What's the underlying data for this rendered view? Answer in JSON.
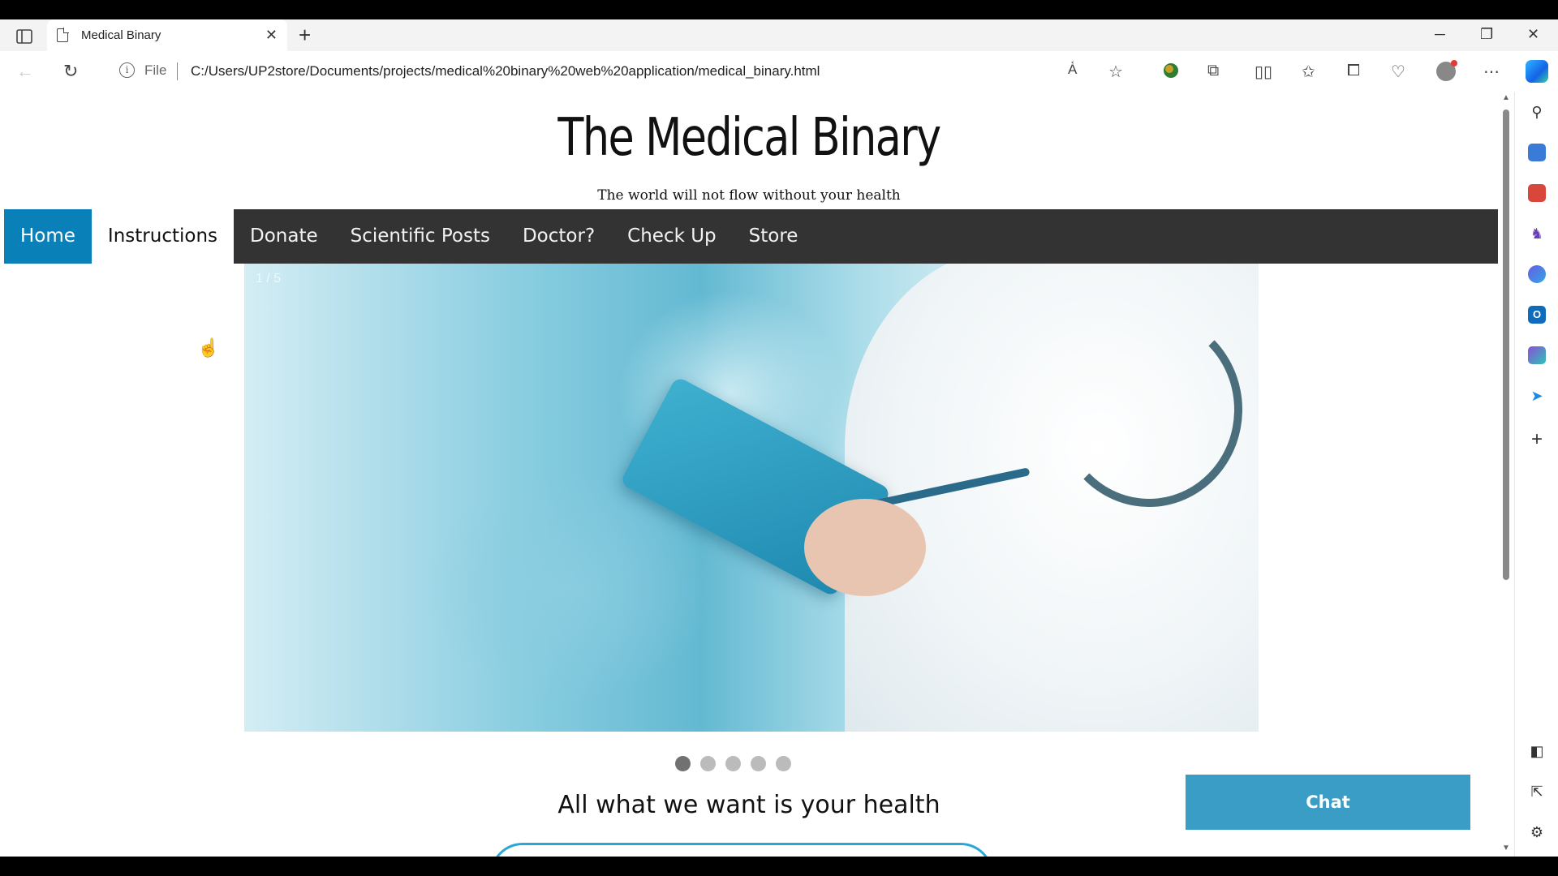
{
  "browser": {
    "tab_title": "Medical Binary",
    "close_tab": "✕",
    "new_tab": "+",
    "file_label": "File",
    "url": "C:/Users/UP2store/Documents/projects/medical%20binary%20web%20application/medical_binary.html",
    "window": {
      "minimize": "─",
      "restore": "❐",
      "close": "✕"
    }
  },
  "site": {
    "title": "The Medical Binary",
    "subtitle": "The world will not flow without your health",
    "nav": [
      {
        "label": "Home",
        "state": "active"
      },
      {
        "label": "Instructions",
        "state": "hover"
      },
      {
        "label": "Donate"
      },
      {
        "label": "Scientific Posts"
      },
      {
        "label": "Doctor?"
      },
      {
        "label": "Check Up"
      },
      {
        "label": "Store"
      }
    ],
    "slideshow": {
      "number_text": "1 / 5",
      "total_slides": 5,
      "active_slide": 1
    },
    "tagline": "All what we want is your health",
    "chat_button": "Chat"
  },
  "colors": {
    "nav_bg": "#333333",
    "nav_active": "#0a80b8",
    "chat_button": "#3a9dc6"
  },
  "icons": {
    "toolbar": [
      "read-aloud-icon",
      "favorite-star-icon",
      "extension-globe-icon",
      "extensions-puzzle-icon",
      "split-screen-icon",
      "favorites-icon",
      "collections-icon",
      "performance-heart-icon",
      "profile-avatar-icon",
      "more-icon",
      "copilot-icon"
    ],
    "sidebar": [
      "search-icon",
      "shopping-tag-icon",
      "tools-briefcase-icon",
      "games-icon",
      "microsoft365-icon",
      "outlook-icon",
      "designer-icon",
      "send-icon",
      "add-icon",
      "hide-sidebar-icon",
      "open-external-icon",
      "settings-icon"
    ]
  }
}
